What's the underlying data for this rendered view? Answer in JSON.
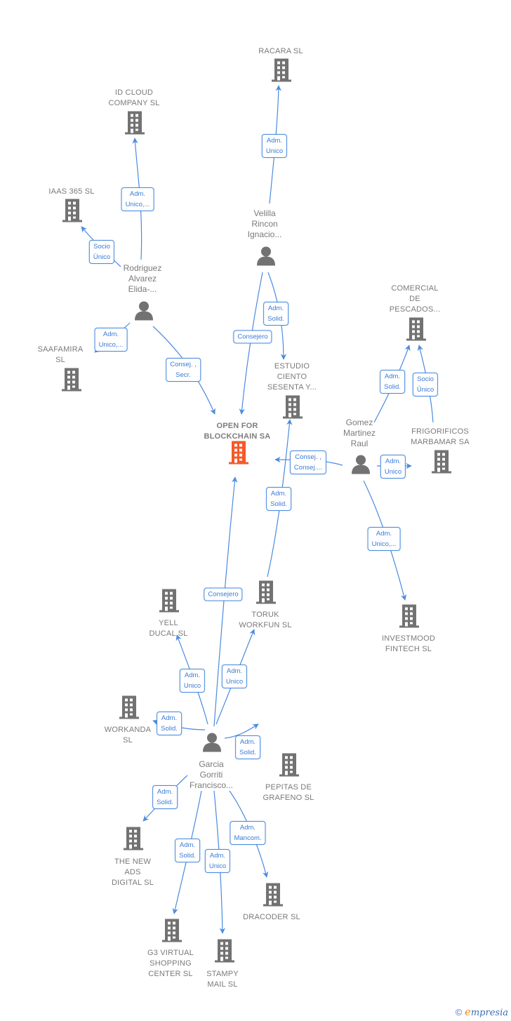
{
  "colors": {
    "edge": "#4a8bdf",
    "node_gray": "#727272",
    "focus": "#f45a28",
    "label_text": "#7a7a7a",
    "edge_label_text": "#3a7bd5"
  },
  "focus_company": {
    "name": "OPEN FOR\nBLOCKCHAIN SA",
    "icon": "building-icon"
  },
  "companies": [
    {
      "id": "racara",
      "name": "RACARA  SL",
      "icon": "building-icon"
    },
    {
      "id": "idcloud",
      "name": "ID CLOUD\nCOMPANY  SL",
      "icon": "building-icon"
    },
    {
      "id": "iaas365",
      "name": "IAAS 365 SL",
      "icon": "building-icon"
    },
    {
      "id": "saafamira",
      "name": "SAAFAMIRA\nSL",
      "icon": "building-icon"
    },
    {
      "id": "estudio",
      "name": "ESTUDIO\nCIENTO\nSESENTA Y...",
      "icon": "building-icon"
    },
    {
      "id": "comercial",
      "name": "COMERCIAL\nDE\nPESCADOS...",
      "icon": "building-icon"
    },
    {
      "id": "frigorificos",
      "name": "FRIGORIFICOS\nMARBAMAR SA",
      "icon": "building-icon"
    },
    {
      "id": "investmood",
      "name": "INVESTMOOD\nFINTECH  SL",
      "icon": "building-icon"
    },
    {
      "id": "yell",
      "name": "YELL\nDUCAL SL",
      "icon": "building-icon"
    },
    {
      "id": "toruk",
      "name": "TORUK\nWORKFUN  SL",
      "icon": "building-icon"
    },
    {
      "id": "workanda",
      "name": "WORKANDA\nSL",
      "icon": "building-icon"
    },
    {
      "id": "pepitas",
      "name": "PEPITAS DE\nGRAFENO  SL",
      "icon": "building-icon"
    },
    {
      "id": "thenewads",
      "name": "THE NEW\nADS\nDIGITAL  SL",
      "icon": "building-icon"
    },
    {
      "id": "dracoder",
      "name": "DRACODER  SL",
      "icon": "building-icon"
    },
    {
      "id": "g3virtual",
      "name": "G3 VIRTUAL\nSHOPPING\nCENTER SL",
      "icon": "building-icon"
    },
    {
      "id": "stampy",
      "name": "STAMPY\nMAIL  SL",
      "icon": "building-icon"
    }
  ],
  "persons": [
    {
      "id": "velilla",
      "name": "Velilla\nRincon\nIgnacio...",
      "icon": "person-icon"
    },
    {
      "id": "rodriguez",
      "name": "Rodriguez\nAlvarez\nElida-...",
      "icon": "person-icon"
    },
    {
      "id": "gomez",
      "name": "Gomez\nMartinez\nRaul",
      "icon": "person-icon"
    },
    {
      "id": "garcia",
      "name": "Garcia\nGorriti\nFrancisco...",
      "icon": "person-icon"
    }
  ],
  "relations": [
    {
      "from": "velilla",
      "to": "racara",
      "label": "Adm.\nUnico"
    },
    {
      "from": "velilla",
      "to": "estudio",
      "label": "Adm.\nSolid."
    },
    {
      "from": "velilla",
      "to": "focus",
      "label": "Consejero"
    },
    {
      "from": "rodriguez",
      "to": "idcloud",
      "label": "Adm.\nUnico,..."
    },
    {
      "from": "rodriguez",
      "to": "iaas365",
      "label": "Socio\nÚnico"
    },
    {
      "from": "rodriguez",
      "to": "saafamira",
      "label": "Adm.\nUnico,..."
    },
    {
      "from": "rodriguez",
      "to": "focus",
      "label": "Consej. ,\nSecr."
    },
    {
      "from": "gomez",
      "to": "comercial",
      "label": "Adm.\nSolid."
    },
    {
      "from": "frigorificos",
      "to": "comercial",
      "label": "Socio\nÚnico"
    },
    {
      "from": "gomez",
      "to": "focus",
      "label": "Consej. ,\nConsej...."
    },
    {
      "from": "gomez",
      "to": "frigorificos",
      "label": "Adm.\nUnico"
    },
    {
      "from": "gomez",
      "to": "investmood",
      "label": "Adm.\nUnico,..."
    },
    {
      "from": "toruk",
      "to": "estudio",
      "label": "Adm.\nSolid."
    },
    {
      "from": "garcia",
      "to": "focus",
      "label": "Consejero"
    },
    {
      "from": "garcia",
      "to": "yell",
      "label": "Adm.\nUnico"
    },
    {
      "from": "garcia",
      "to": "toruk",
      "label": "Adm.\nUnico"
    },
    {
      "from": "garcia",
      "to": "workanda",
      "label": "Adm.\nSolid."
    },
    {
      "from": "garcia",
      "to": "pepitas",
      "label": "Adm.\nSolid."
    },
    {
      "from": "garcia",
      "to": "thenewads",
      "label": "Adm.\nSolid."
    },
    {
      "from": "garcia",
      "to": "g3virtual",
      "label": "Adm.\nSolid."
    },
    {
      "from": "garcia",
      "to": "stampy",
      "label": "Adm.\nUnico"
    },
    {
      "from": "garcia",
      "to": "dracoder",
      "label": "Adm.\nMancom."
    }
  ],
  "footer": {
    "copyright_symbol": "©",
    "brand_initial": "e",
    "brand_rest": "mpresia"
  }
}
